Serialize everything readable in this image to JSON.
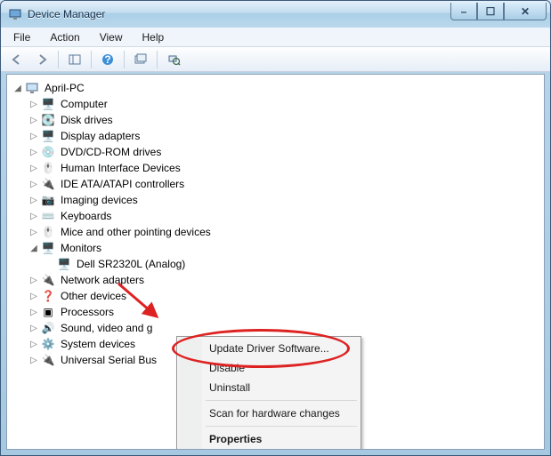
{
  "window": {
    "title": "Device Manager",
    "buttons": {
      "min": "–",
      "max": "☐",
      "close": "✕"
    }
  },
  "menu": {
    "file": "File",
    "action": "Action",
    "view": "View",
    "help": "Help"
  },
  "tree": {
    "root": "April-PC",
    "items": [
      "Computer",
      "Disk drives",
      "Display adapters",
      "DVD/CD-ROM drives",
      "Human Interface Devices",
      "IDE ATA/ATAPI controllers",
      "Imaging devices",
      "Keyboards",
      "Mice and other pointing devices",
      "Monitors",
      "Network adapters",
      "Other devices",
      "Processors",
      "Sound, video and game controllers",
      "System devices",
      "Universal Serial Bus controllers"
    ],
    "monitors_child": "Dell SR2320L (Analog)",
    "truncated": {
      "10": "Network adapters",
      "11": "Other devices",
      "12": "Processors",
      "13": "Sound, video and g",
      "14": "System devices",
      "15": "Universal Serial Bus"
    }
  },
  "context": {
    "update": "Update Driver Software...",
    "disable": "Disable",
    "uninstall": "Uninstall",
    "scan": "Scan for hardware changes",
    "properties": "Properties"
  },
  "icons": {
    "computer": "🖥️",
    "disk": "💽",
    "display": "🖥️",
    "dvd": "💿",
    "hid": "🖱️",
    "ide": "🔌",
    "imaging": "📷",
    "keyboard": "⌨️",
    "mouse": "🖱️",
    "monitor": "🖥️",
    "net": "🔌",
    "other": "❓",
    "cpu": "▣",
    "sound": "🔊",
    "system": "⚙️",
    "usb": "🔌",
    "pc": "🖥️"
  }
}
